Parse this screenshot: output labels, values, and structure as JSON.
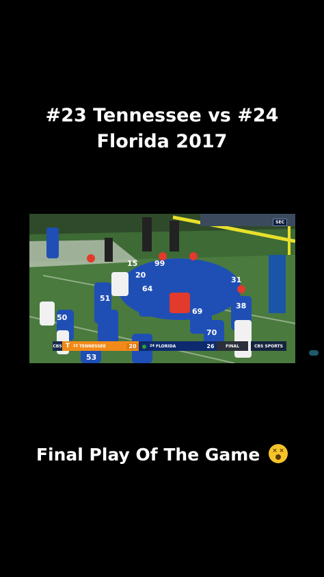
{
  "title": {
    "line1": "#23 Tennessee vs #24",
    "line2": "Florida 2017"
  },
  "video": {
    "network_badge": "SEC",
    "scorebar": {
      "network": "CBS",
      "away_rank": "23",
      "away_team": "TENNESSEE",
      "away_score": "20",
      "home_rank": "24",
      "home_team": "FLORIDA",
      "home_score": "26",
      "status": "FINAL",
      "broadcaster": "CBS SPORTS"
    },
    "away_color": "#f28a19",
    "home_color": "#0d2a6e",
    "jersey_numbers": [
      "51",
      "50",
      "53",
      "64",
      "69",
      "70",
      "38",
      "99",
      "20",
      "31",
      "15"
    ]
  },
  "caption": {
    "text": "Final Play Of The Game",
    "emoji": "dizzy-face-emoji"
  }
}
